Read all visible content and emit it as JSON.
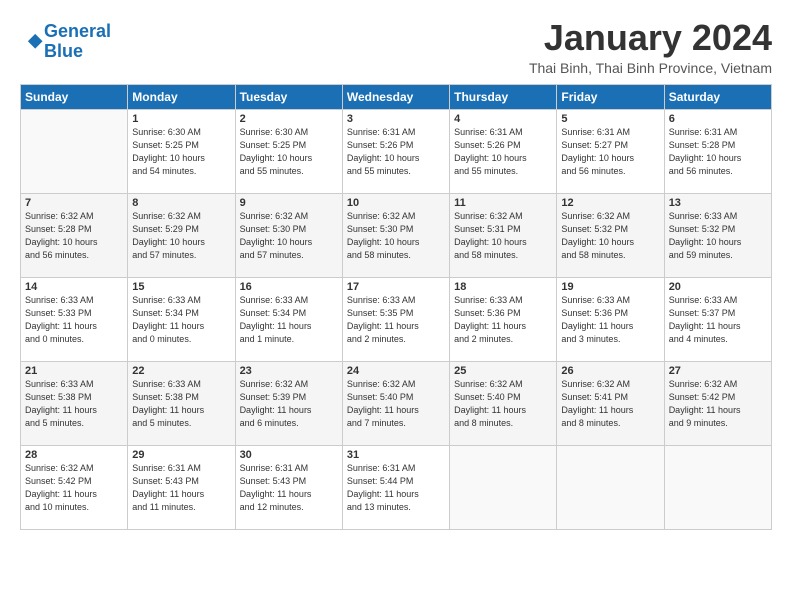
{
  "logo": {
    "line1": "General",
    "line2": "Blue"
  },
  "title": "January 2024",
  "location": "Thai Binh, Thai Binh Province, Vietnam",
  "header_days": [
    "Sunday",
    "Monday",
    "Tuesday",
    "Wednesday",
    "Thursday",
    "Friday",
    "Saturday"
  ],
  "weeks": [
    [
      {
        "day": "",
        "info": ""
      },
      {
        "day": "1",
        "info": "Sunrise: 6:30 AM\nSunset: 5:25 PM\nDaylight: 10 hours\nand 54 minutes."
      },
      {
        "day": "2",
        "info": "Sunrise: 6:30 AM\nSunset: 5:25 PM\nDaylight: 10 hours\nand 55 minutes."
      },
      {
        "day": "3",
        "info": "Sunrise: 6:31 AM\nSunset: 5:26 PM\nDaylight: 10 hours\nand 55 minutes."
      },
      {
        "day": "4",
        "info": "Sunrise: 6:31 AM\nSunset: 5:26 PM\nDaylight: 10 hours\nand 55 minutes."
      },
      {
        "day": "5",
        "info": "Sunrise: 6:31 AM\nSunset: 5:27 PM\nDaylight: 10 hours\nand 56 minutes."
      },
      {
        "day": "6",
        "info": "Sunrise: 6:31 AM\nSunset: 5:28 PM\nDaylight: 10 hours\nand 56 minutes."
      }
    ],
    [
      {
        "day": "7",
        "info": "Sunrise: 6:32 AM\nSunset: 5:28 PM\nDaylight: 10 hours\nand 56 minutes."
      },
      {
        "day": "8",
        "info": "Sunrise: 6:32 AM\nSunset: 5:29 PM\nDaylight: 10 hours\nand 57 minutes."
      },
      {
        "day": "9",
        "info": "Sunrise: 6:32 AM\nSunset: 5:30 PM\nDaylight: 10 hours\nand 57 minutes."
      },
      {
        "day": "10",
        "info": "Sunrise: 6:32 AM\nSunset: 5:30 PM\nDaylight: 10 hours\nand 58 minutes."
      },
      {
        "day": "11",
        "info": "Sunrise: 6:32 AM\nSunset: 5:31 PM\nDaylight: 10 hours\nand 58 minutes."
      },
      {
        "day": "12",
        "info": "Sunrise: 6:32 AM\nSunset: 5:32 PM\nDaylight: 10 hours\nand 58 minutes."
      },
      {
        "day": "13",
        "info": "Sunrise: 6:33 AM\nSunset: 5:32 PM\nDaylight: 10 hours\nand 59 minutes."
      }
    ],
    [
      {
        "day": "14",
        "info": "Sunrise: 6:33 AM\nSunset: 5:33 PM\nDaylight: 11 hours\nand 0 minutes."
      },
      {
        "day": "15",
        "info": "Sunrise: 6:33 AM\nSunset: 5:34 PM\nDaylight: 11 hours\nand 0 minutes."
      },
      {
        "day": "16",
        "info": "Sunrise: 6:33 AM\nSunset: 5:34 PM\nDaylight: 11 hours\nand 1 minute."
      },
      {
        "day": "17",
        "info": "Sunrise: 6:33 AM\nSunset: 5:35 PM\nDaylight: 11 hours\nand 2 minutes."
      },
      {
        "day": "18",
        "info": "Sunrise: 6:33 AM\nSunset: 5:36 PM\nDaylight: 11 hours\nand 2 minutes."
      },
      {
        "day": "19",
        "info": "Sunrise: 6:33 AM\nSunset: 5:36 PM\nDaylight: 11 hours\nand 3 minutes."
      },
      {
        "day": "20",
        "info": "Sunrise: 6:33 AM\nSunset: 5:37 PM\nDaylight: 11 hours\nand 4 minutes."
      }
    ],
    [
      {
        "day": "21",
        "info": "Sunrise: 6:33 AM\nSunset: 5:38 PM\nDaylight: 11 hours\nand 5 minutes."
      },
      {
        "day": "22",
        "info": "Sunrise: 6:33 AM\nSunset: 5:38 PM\nDaylight: 11 hours\nand 5 minutes."
      },
      {
        "day": "23",
        "info": "Sunrise: 6:32 AM\nSunset: 5:39 PM\nDaylight: 11 hours\nand 6 minutes."
      },
      {
        "day": "24",
        "info": "Sunrise: 6:32 AM\nSunset: 5:40 PM\nDaylight: 11 hours\nand 7 minutes."
      },
      {
        "day": "25",
        "info": "Sunrise: 6:32 AM\nSunset: 5:40 PM\nDaylight: 11 hours\nand 8 minutes."
      },
      {
        "day": "26",
        "info": "Sunrise: 6:32 AM\nSunset: 5:41 PM\nDaylight: 11 hours\nand 8 minutes."
      },
      {
        "day": "27",
        "info": "Sunrise: 6:32 AM\nSunset: 5:42 PM\nDaylight: 11 hours\nand 9 minutes."
      }
    ],
    [
      {
        "day": "28",
        "info": "Sunrise: 6:32 AM\nSunset: 5:42 PM\nDaylight: 11 hours\nand 10 minutes."
      },
      {
        "day": "29",
        "info": "Sunrise: 6:31 AM\nSunset: 5:43 PM\nDaylight: 11 hours\nand 11 minutes."
      },
      {
        "day": "30",
        "info": "Sunrise: 6:31 AM\nSunset: 5:43 PM\nDaylight: 11 hours\nand 12 minutes."
      },
      {
        "day": "31",
        "info": "Sunrise: 6:31 AM\nSunset: 5:44 PM\nDaylight: 11 hours\nand 13 minutes."
      },
      {
        "day": "",
        "info": ""
      },
      {
        "day": "",
        "info": ""
      },
      {
        "day": "",
        "info": ""
      }
    ]
  ]
}
